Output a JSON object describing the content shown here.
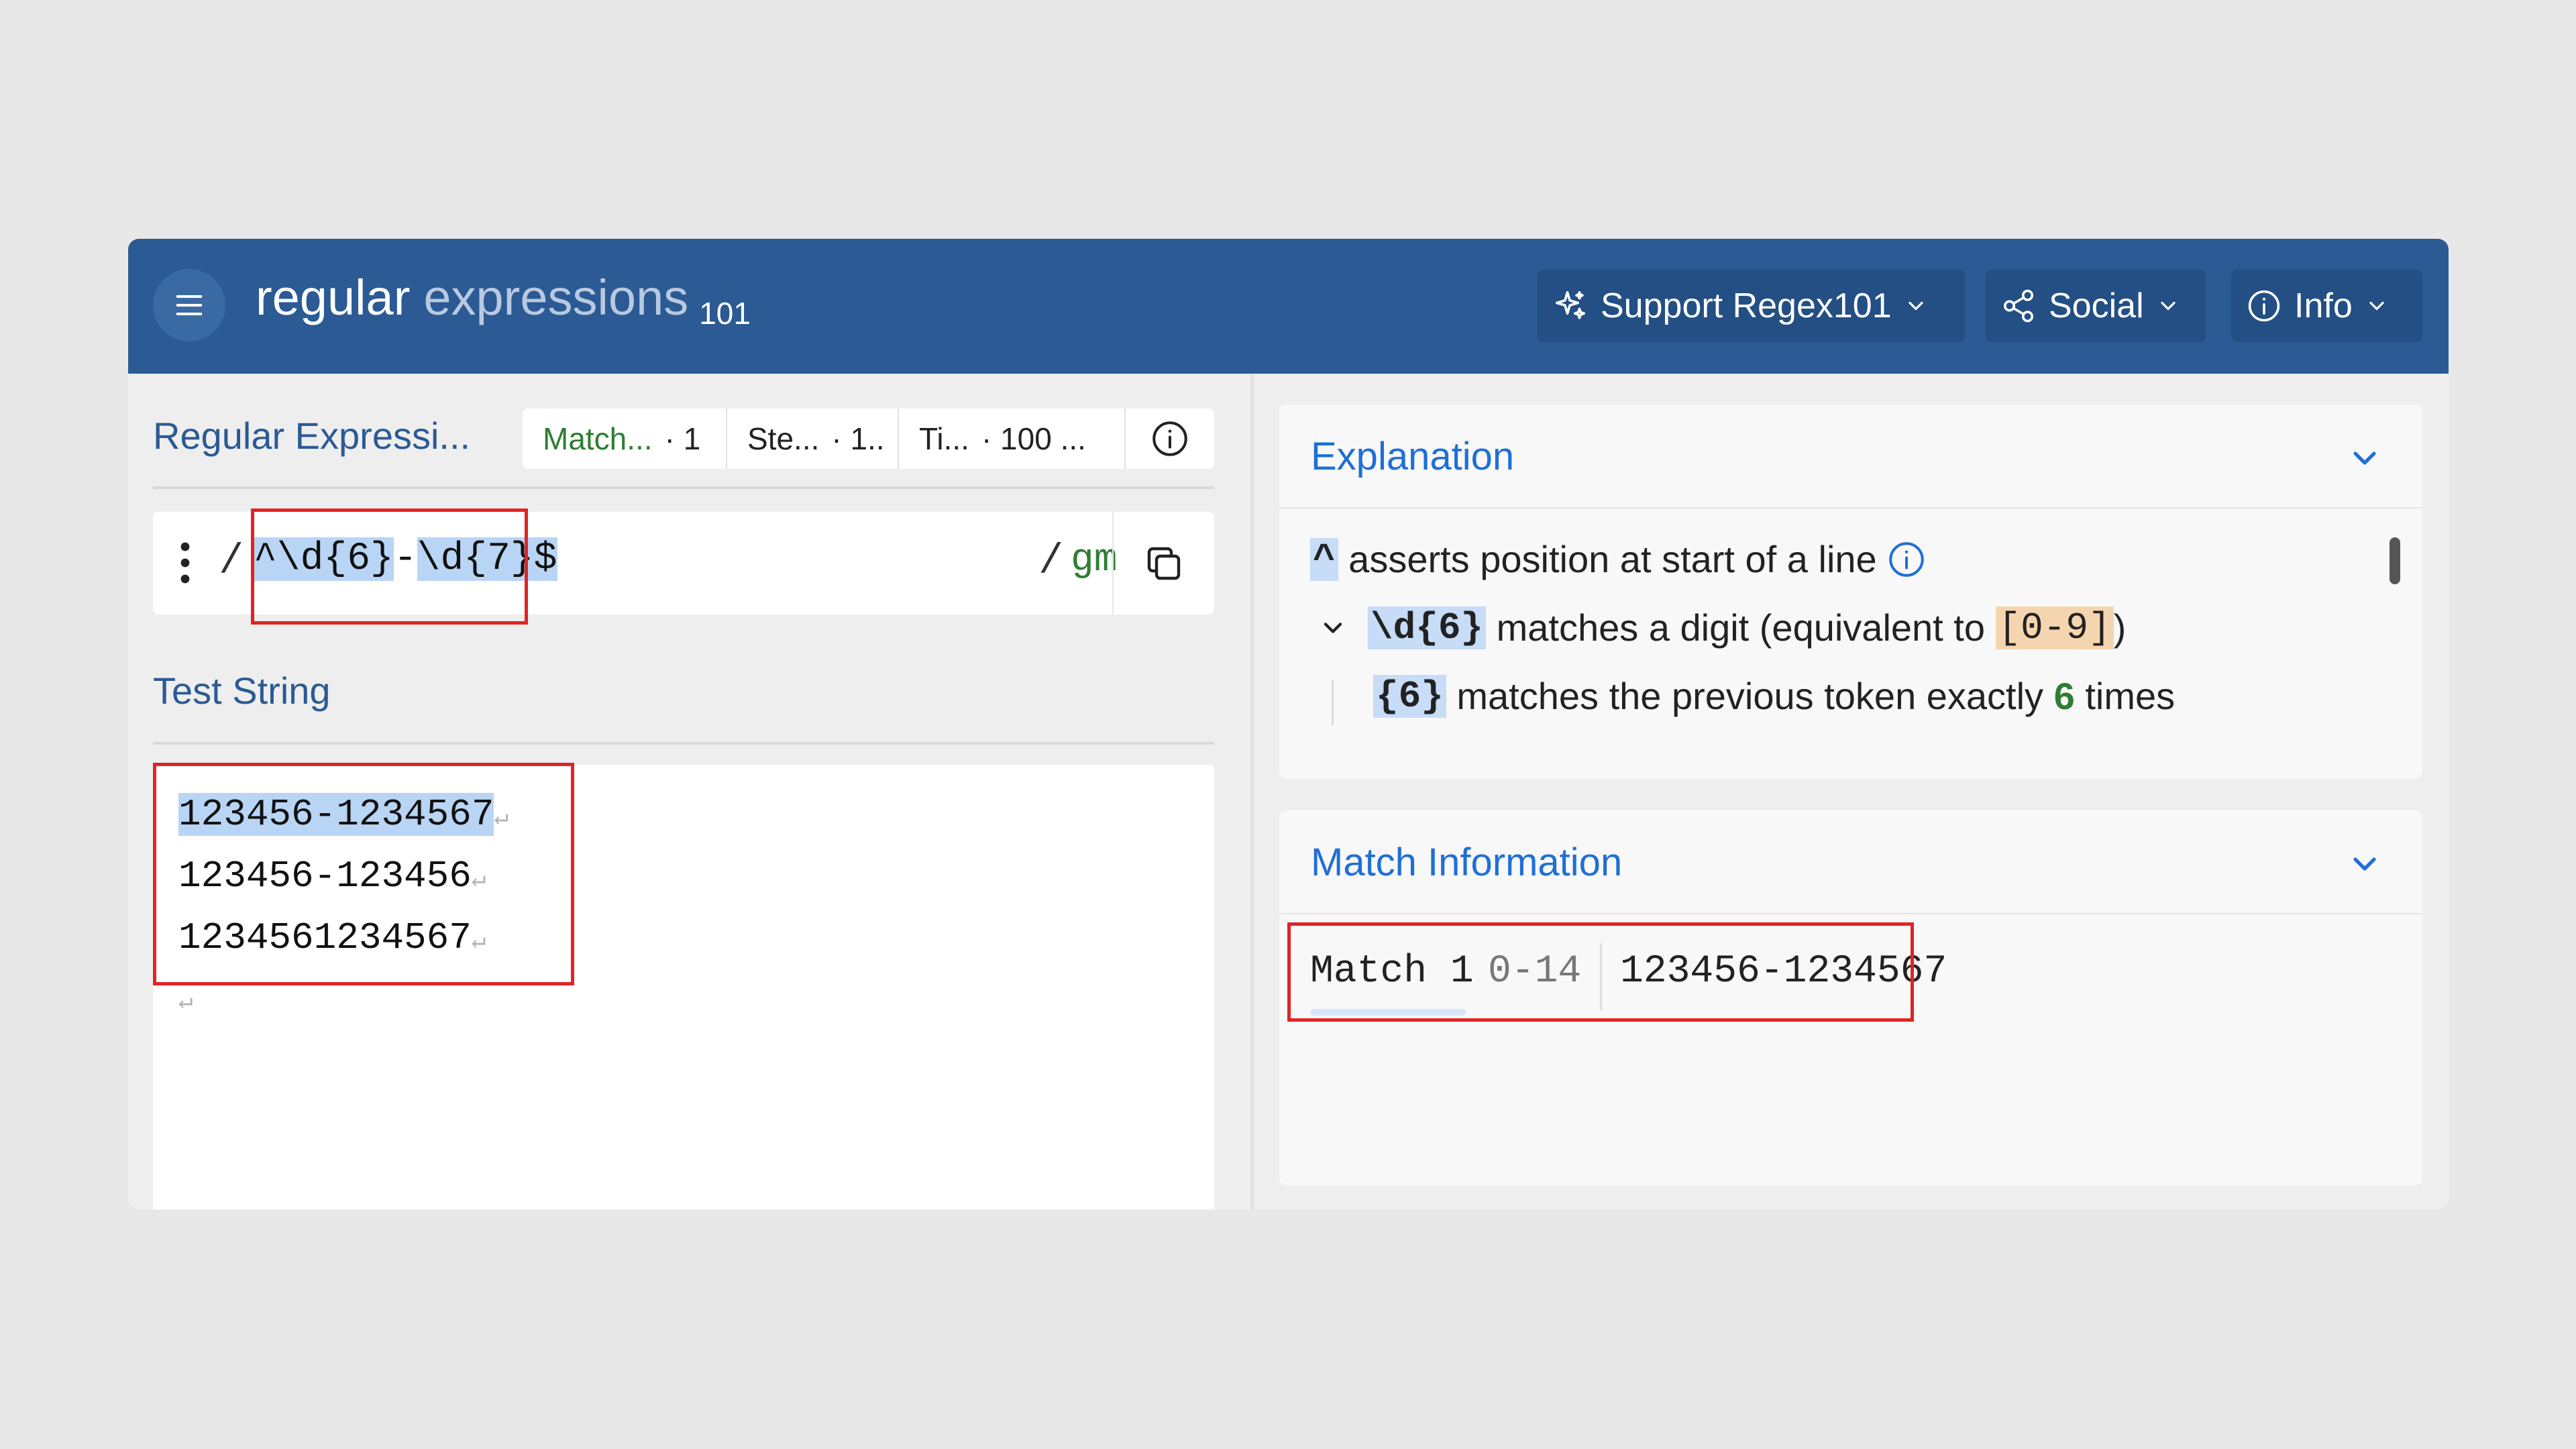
{
  "header": {
    "logo_word1": "regular",
    "logo_word2": "expressions",
    "logo_sub": "101",
    "menu_icon": "hamburger-icon",
    "buttons": [
      {
        "label": "Support Regex101",
        "icon": "sparkle-icon"
      },
      {
        "label": "Social",
        "icon": "share-icon"
      },
      {
        "label": "Info",
        "icon": "info-icon"
      }
    ]
  },
  "regex_panel": {
    "title": "Regular Expressi...",
    "stats": [
      {
        "label": "Match...",
        "value": "· 1"
      },
      {
        "label": "Ste...",
        "value": "· 1.."
      },
      {
        "label": "Ti...",
        "value": "· 100 ..."
      }
    ],
    "delimiter_open": "/",
    "pattern_parts": [
      "^\\d{6}",
      "-",
      "\\d{7}$"
    ],
    "delimiter_close": "/",
    "flags": "gm"
  },
  "test_string": {
    "title": "Test String",
    "lines": [
      "123456-1234567",
      "123456-123456",
      "1234561234567"
    ],
    "newline_glyph": "↵"
  },
  "explanation": {
    "title": "Explanation",
    "rows": [
      {
        "token": "^",
        "text": " asserts position at start of a line"
      },
      {
        "token": "\\d{6}",
        "text_before": " matches a digit (equivalent to ",
        "range": "[0-9]",
        "text_after": ")"
      },
      {
        "token": "{6}",
        "text_before": " matches the previous token exactly ",
        "count": "6",
        "text_after": " times"
      }
    ]
  },
  "match_info": {
    "title": "Match Information",
    "label": "Match 1",
    "range": "0-14",
    "value": "123456-1234567"
  },
  "colors": {
    "header_bg": "#2b5a94",
    "accent_blue": "#1f6fd6",
    "highlight": "#b9d5f5",
    "annotation_red": "#e02424",
    "flag_green": "#2e7d32"
  }
}
